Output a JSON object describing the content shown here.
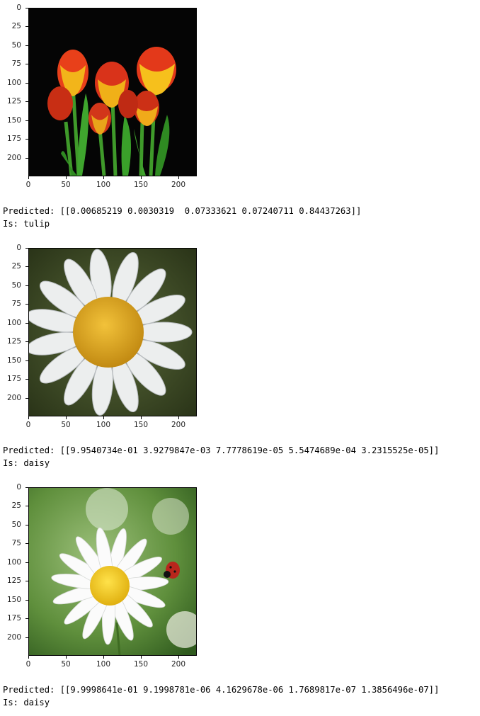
{
  "axes": {
    "yticks": [
      "0",
      "25",
      "50",
      "75",
      "100",
      "125",
      "150",
      "175",
      "200"
    ],
    "xticks": [
      "0",
      "50",
      "100",
      "150",
      "200"
    ]
  },
  "cells": [
    {
      "image": "tulips-photo",
      "predicted": "Predicted: [[0.00685219 0.0030319  0.07333621 0.07240711 0.84437263]]",
      "is": "Is: tulip"
    },
    {
      "image": "daisy-closeup-photo",
      "predicted": "Predicted: [[9.9540734e-01 3.9279847e-03 7.7778619e-05 5.5474689e-04 3.2315525e-05]]",
      "is": "Is: daisy"
    },
    {
      "image": "daisy-with-ladybug-photo",
      "predicted": "Predicted: [[9.9998641e-01 9.1998781e-06 4.1629678e-06 1.7689817e-07 1.3856496e-07]]",
      "is": "Is: daisy"
    }
  ]
}
